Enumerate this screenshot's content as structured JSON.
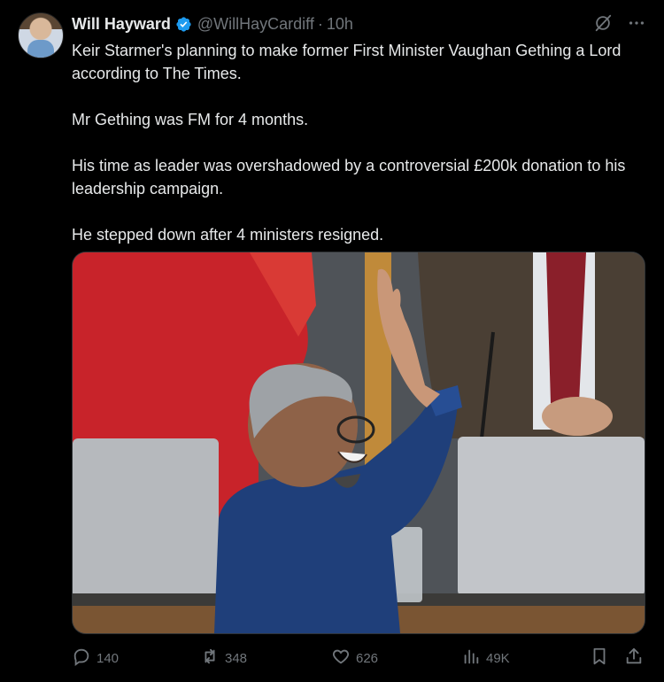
{
  "author": {
    "name": "Will Hayward",
    "handle": "@WillHayCardiff",
    "separator": "·",
    "time": "10h"
  },
  "tweet": {
    "paragraphs": [
      "Keir Starmer's planning to make former First Minister Vaughan Gething a Lord according to The Times.",
      "Mr Gething was FM for 4 months.",
      "His time as leader was overshadowed by a controversial £200k donation to his leadership campaign.",
      "He stepped down after 4 ministers resigned."
    ]
  },
  "media": {
    "type": "photo"
  },
  "actions": {
    "replies": "140",
    "reposts": "348",
    "likes": "626",
    "views": "49K"
  },
  "colors": {
    "background": "#000000",
    "text": "#e7e9ea",
    "muted": "#71767b",
    "verified": "#1d9bf0"
  },
  "icons": [
    "grok-icon",
    "more-icon",
    "reply-icon",
    "repost-icon",
    "like-icon",
    "views-icon",
    "bookmark-icon",
    "share-icon"
  ]
}
